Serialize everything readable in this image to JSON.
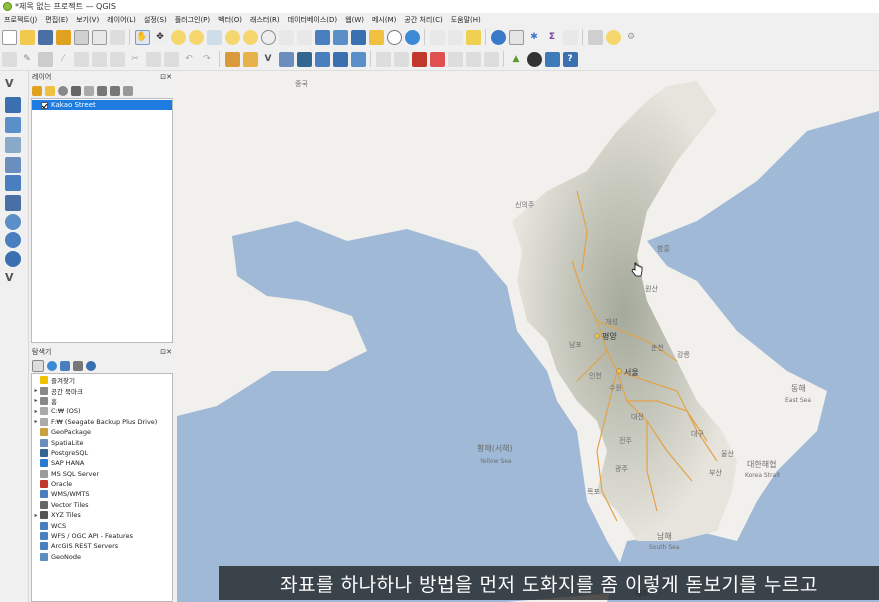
{
  "window": {
    "title": "*제목 없는 프로젝트 — QGIS"
  },
  "menu": [
    "프로젝트(J)",
    "편집(E)",
    "보기(V)",
    "레이어(L)",
    "설정(S)",
    "플러그인(P)",
    "벡터(O)",
    "래스터(R)",
    "데이터베이스(D)",
    "웹(W)",
    "메시(M)",
    "공간 처리(C)",
    "도움말(H)"
  ],
  "layers_panel": {
    "title": "레이어",
    "layers": [
      {
        "name": "Kakao Street",
        "checked": true
      }
    ]
  },
  "browser_panel": {
    "title": "탐색기",
    "items": [
      {
        "label": "즐겨찾기",
        "expand": "",
        "icon": "star-icon",
        "color": "#f2c200"
      },
      {
        "label": "공간 북마크",
        "expand": "▸",
        "icon": "bookmark-icon",
        "color": "#888"
      },
      {
        "label": "홈",
        "expand": "▸",
        "icon": "home-icon",
        "color": "#888"
      },
      {
        "label": "C:₩ (OS)",
        "expand": "▸",
        "icon": "drive-icon",
        "color": "#aaa"
      },
      {
        "label": "F:₩ (Seagate Backup Plus Drive)",
        "expand": "▸",
        "icon": "drive-icon",
        "color": "#aaa"
      },
      {
        "label": "GeoPackage",
        "expand": "",
        "icon": "geopackage-icon",
        "color": "#c8a040"
      },
      {
        "label": "SpatiaLite",
        "expand": "",
        "icon": "spatialite-icon",
        "color": "#6a8fbf"
      },
      {
        "label": "PostgreSQL",
        "expand": "",
        "icon": "postgresql-icon",
        "color": "#336791"
      },
      {
        "label": "SAP HANA",
        "expand": "",
        "icon": "sap-hana-icon",
        "color": "#2a7ad0"
      },
      {
        "label": "MS SQL Server",
        "expand": "",
        "icon": "mssql-icon",
        "color": "#9a9a9a"
      },
      {
        "label": "Oracle",
        "expand": "",
        "icon": "oracle-icon",
        "color": "#c0392b"
      },
      {
        "label": "WMS/WMTS",
        "expand": "",
        "icon": "wms-icon",
        "color": "#4a7fbf"
      },
      {
        "label": "Vector Tiles",
        "expand": "",
        "icon": "vector-tiles-icon",
        "color": "#666"
      },
      {
        "label": "XYZ Tiles",
        "expand": "▸",
        "icon": "xyz-tiles-icon",
        "color": "#555"
      },
      {
        "label": "WCS",
        "expand": "",
        "icon": "wcs-icon",
        "color": "#4a7fbf"
      },
      {
        "label": "WFS / OGC API - Features",
        "expand": "",
        "icon": "wfs-icon",
        "color": "#4a7fbf"
      },
      {
        "label": "ArcGIS REST Servers",
        "expand": "",
        "icon": "arcgis-icon",
        "color": "#4a7fbf"
      },
      {
        "label": "GeoNode",
        "expand": "",
        "icon": "geonode-icon",
        "color": "#5a8fbf"
      }
    ]
  },
  "map": {
    "labels": {
      "china": "중국",
      "yellow_sea_ko": "황해(서해)",
      "yellow_sea_en": "Yellow Sea",
      "east_sea_ko": "동해",
      "east_sea_en": "East Sea",
      "korea_strait_ko": "대한해협",
      "korea_strait_en": "Korea Strait",
      "south_sea_ko": "남해",
      "south_sea_en": "South Sea",
      "pyongyang": "평양",
      "seoul": "서울",
      "sinuiju": "신의주",
      "gaeseong": "개성",
      "chuncheon": "춘천",
      "gangneung": "강릉",
      "daejeon": "대전",
      "daegu": "대구",
      "ulsan": "울산",
      "busan": "부산",
      "gwangju": "광주",
      "jeonju": "전주",
      "suwon": "수원",
      "incheon": "인천",
      "mokpo": "목포",
      "jeju": "제주",
      "hamheung": "함흥",
      "wonsan": "원산",
      "nampo": "남포"
    },
    "colors": {
      "sea": "#9fb9d6",
      "land": "#f2f0ec",
      "relief": "#b9bcaf",
      "road": "#e3a24a",
      "label": "#6e6e6e"
    }
  },
  "subtitle": "좌표를 하나하나 방법을 먼저 도화지를 좀 이렇게 돋보기를 누르고"
}
